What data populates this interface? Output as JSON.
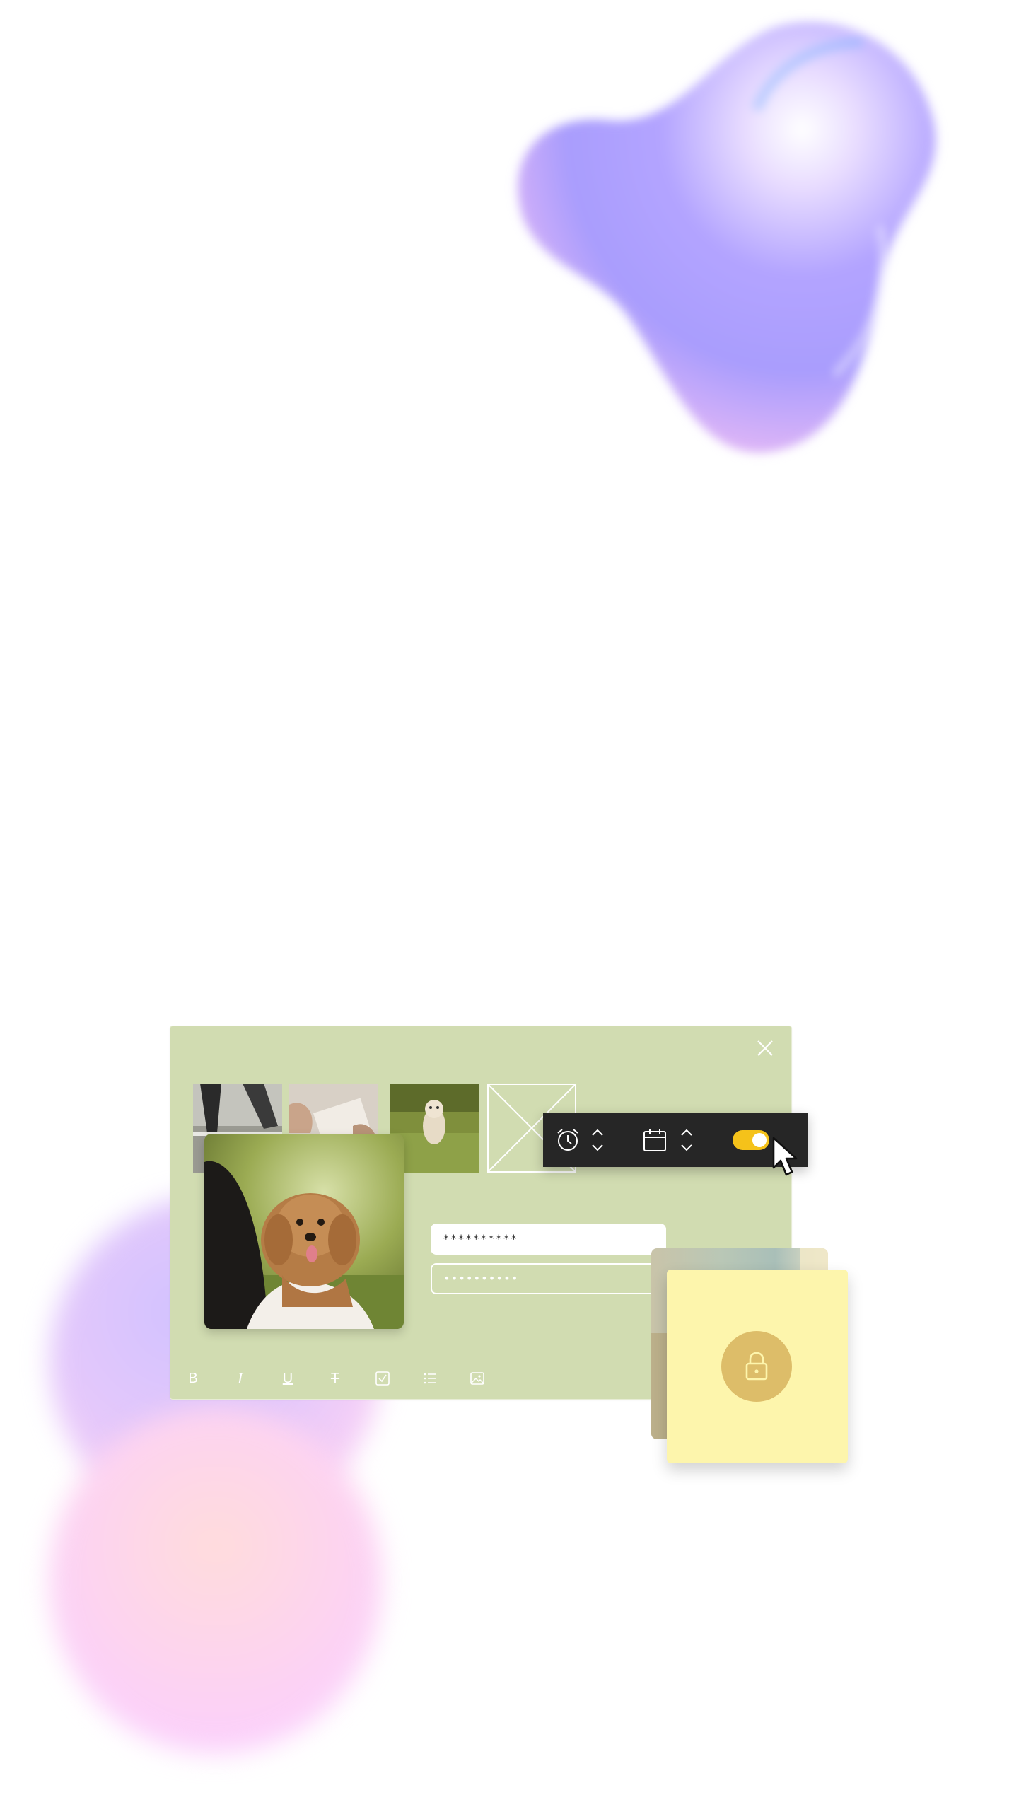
{
  "editor": {
    "password_value_1": "**********",
    "password_value_2": "••••••••••",
    "toolbar_bold": "B",
    "toolbar_italic": "I",
    "toolbar_underline": "U",
    "toolbar_strike": "T"
  },
  "quick_bar": {
    "toggle_on": true,
    "toggle_color": "#f5c21a"
  },
  "colors": {
    "window_bg": "#d1dcb1",
    "dark_bar": "#262626",
    "card_front": "#fdf5ac",
    "lock_circle": "#ddbd69"
  },
  "icons": [
    "close-icon",
    "alarm-clock-icon",
    "calendar-icon",
    "stepper-icon",
    "lock-icon",
    "bold-icon",
    "italic-icon",
    "underline-icon",
    "strikethrough-icon",
    "checkbox-icon",
    "list-icon",
    "image-icon",
    "cursor-pointer-icon"
  ]
}
